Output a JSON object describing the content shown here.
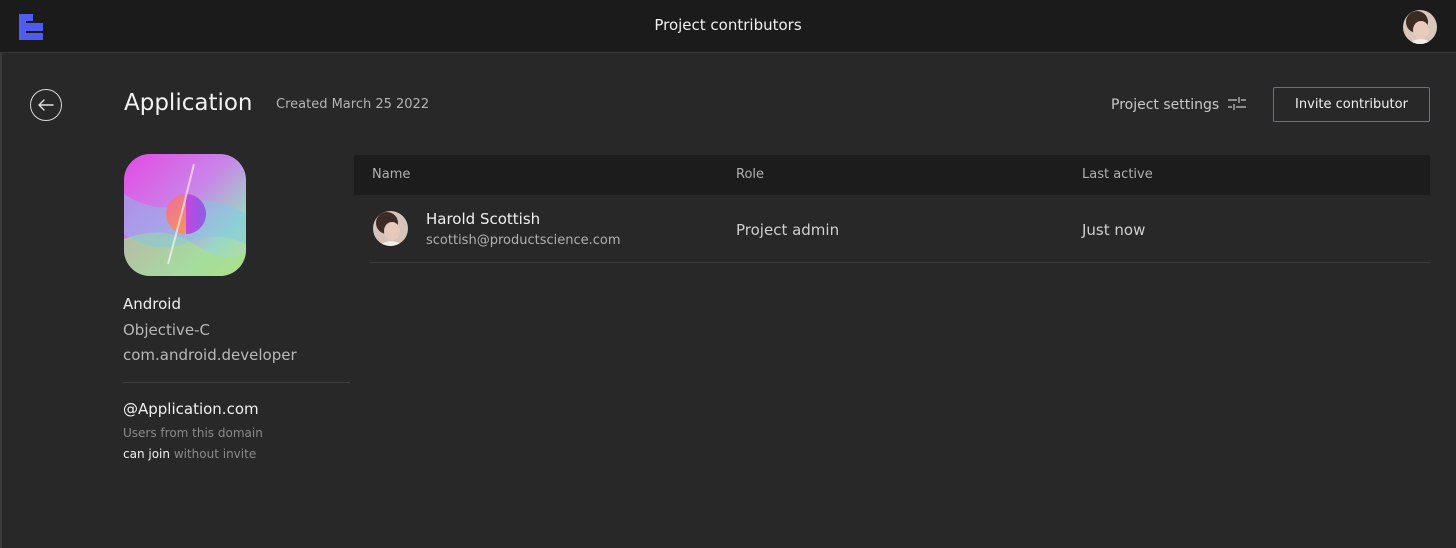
{
  "topbar": {
    "title": "Project contributors",
    "brand_color": "#4f5cf0"
  },
  "header": {
    "project_name": "Application",
    "created": "Created March 25 2022",
    "settings_label": "Project settings",
    "invite_label": "Invite contributor",
    "accent_color": "#5b63e6"
  },
  "info": {
    "platform": "Android",
    "language": "Objective-C",
    "bundle_id": "com.android.developer",
    "domain": "@Application.com",
    "note_line1": "Users from this domain",
    "note_highlight": "can join",
    "note_rest": " without invite"
  },
  "table": {
    "columns": [
      "Name",
      "Role",
      "Last active"
    ],
    "rows": [
      {
        "name": "Harold Scottish",
        "email": "scottish@productscience.com",
        "role": "Project admin",
        "last_active": "Just now"
      }
    ]
  },
  "icons": {
    "logo": "brand-logo-icon",
    "back": "arrow-left-icon",
    "settings": "sliders-icon"
  }
}
